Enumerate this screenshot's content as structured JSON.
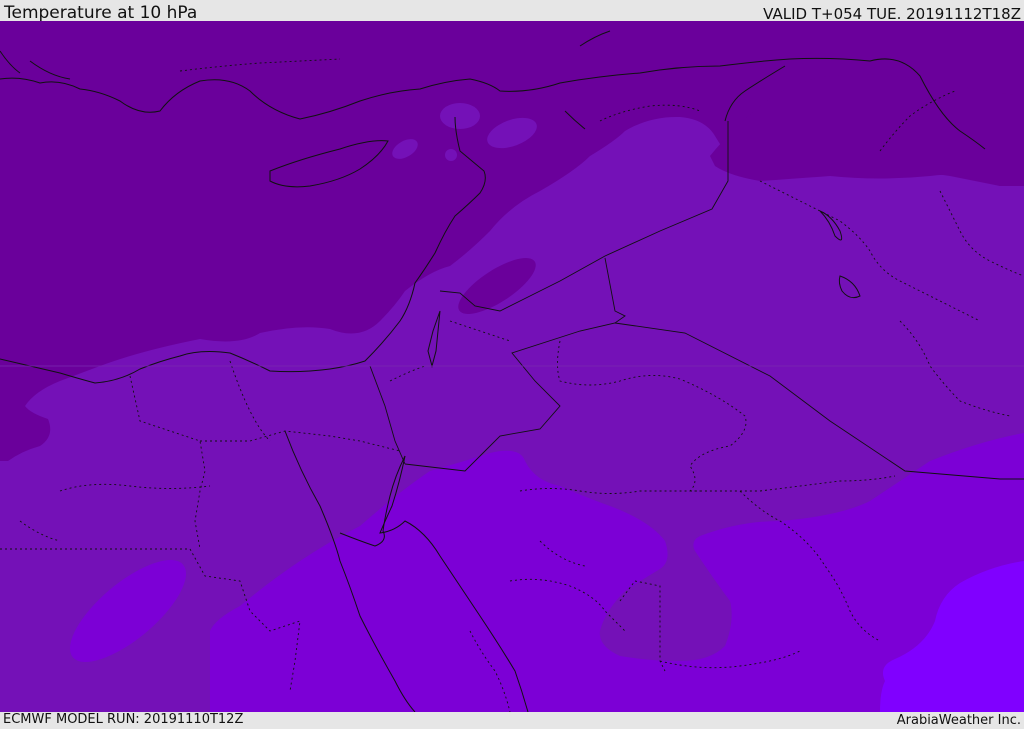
{
  "header": {
    "title": "Temperature at 10 hPa",
    "valid_time": "VALID T+054 TUE. 20191112T18Z"
  },
  "footer": {
    "model_run": "ECMWF MODEL RUN: 20191110T12Z",
    "credit": "ArabiaWeather Inc."
  },
  "map": {
    "variable": "temperature",
    "level": "10 hPa",
    "shading_colors": [
      "#6a009b",
      "#7411b7",
      "#7c00d6",
      "#8000ff"
    ],
    "linework": [
      "coastlines",
      "country-borders",
      "province-borders"
    ]
  }
}
